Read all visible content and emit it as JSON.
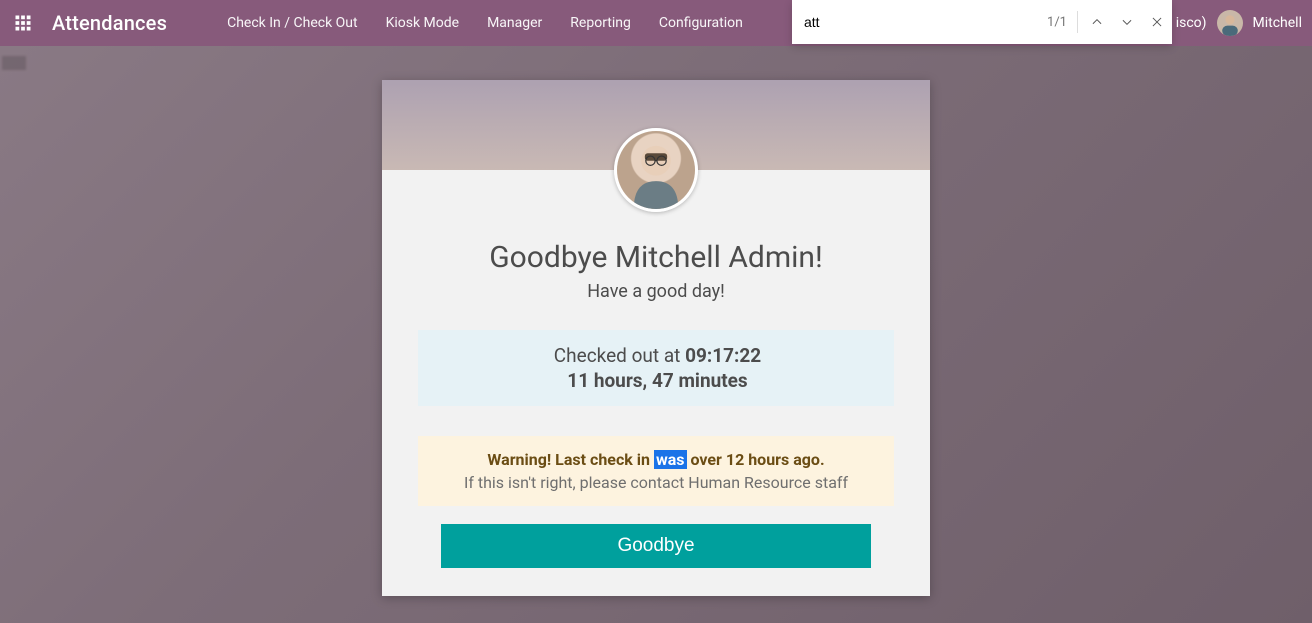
{
  "nav": {
    "brand": "Attendances",
    "links": [
      "Check In / Check Out",
      "Kiosk Mode",
      "Manager",
      "Reporting",
      "Configuration"
    ],
    "company_peek": "isco)",
    "user": "Mitchell"
  },
  "findbar": {
    "query": "att",
    "count": "1/1"
  },
  "card": {
    "title": "Goodbye Mitchell Admin!",
    "subtitle": "Have a good day!",
    "checkout_line1_pre": "Checked out at ",
    "checkout_time": "09:17:22",
    "checkout_line2": "11 hours, 47 minutes",
    "warning_pre": "Warning! Last check in ",
    "warning_highlight": "was",
    "warning_post": " over 12 hours ago.",
    "warning_help": "If this isn't right, please contact Human Resource staff",
    "goodbye_button": "Goodbye"
  }
}
